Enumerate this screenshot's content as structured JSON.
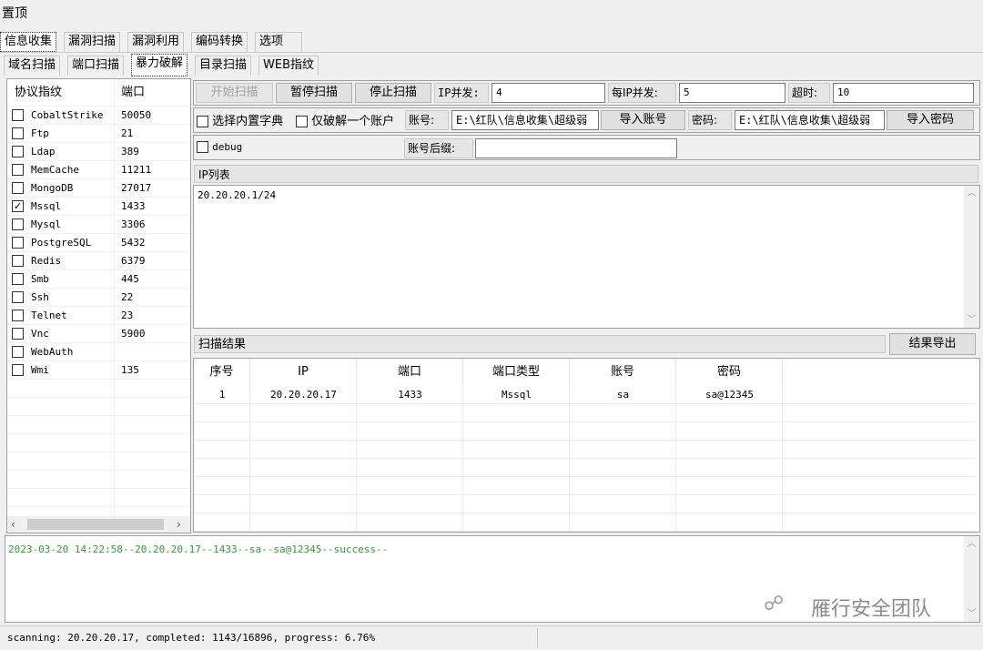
{
  "window": {
    "title": "置顶"
  },
  "top_tabs": [
    "信息收集",
    "漏洞扫描",
    "漏洞利用",
    "编码转换",
    "选项"
  ],
  "sub_tabs": [
    "域名扫描",
    "端口扫描",
    "暴力破解",
    "目录扫描",
    "WEB指纹"
  ],
  "protocols": {
    "header_name": "协议指纹",
    "header_port": "端口",
    "rows": [
      {
        "name": "CobaltStrike",
        "port": "50050",
        "checked": false
      },
      {
        "name": "Ftp",
        "port": "21",
        "checked": false
      },
      {
        "name": "Ldap",
        "port": "389",
        "checked": false
      },
      {
        "name": "MemCache",
        "port": "11211",
        "checked": false
      },
      {
        "name": "MongoDB",
        "port": "27017",
        "checked": false
      },
      {
        "name": "Mssql",
        "port": "1433",
        "checked": true
      },
      {
        "name": "Mysql",
        "port": "3306",
        "checked": false
      },
      {
        "name": "PostgreSQL",
        "port": "5432",
        "checked": false
      },
      {
        "name": "Redis",
        "port": "6379",
        "checked": false
      },
      {
        "name": "Smb",
        "port": "445",
        "checked": false
      },
      {
        "name": "Ssh",
        "port": "22",
        "checked": false
      },
      {
        "name": "Telnet",
        "port": "23",
        "checked": false
      },
      {
        "name": "Vnc",
        "port": "5900",
        "checked": false
      },
      {
        "name": "WebAuth",
        "port": "",
        "checked": false
      },
      {
        "name": "Wmi",
        "port": "135",
        "checked": false
      }
    ]
  },
  "controls": {
    "start_label": "开始扫描",
    "pause_label": "暂停扫描",
    "stop_label": "停止扫描",
    "ip_concurrency_label": "IP并发:",
    "ip_concurrency_value": "4",
    "per_ip_concurrency_label": "每IP并发:",
    "per_ip_concurrency_value": "5",
    "timeout_label": "超时:",
    "timeout_value": "10",
    "builtin_dict_label": "选择内置字典",
    "single_account_label": "仅破解一个账户",
    "account_label": "账号:",
    "account_path": "E:\\红队\\信息收集\\超级弱",
    "import_account_label": "导入账号",
    "password_label": "密码:",
    "password_path": "E:\\红队\\信息收集\\超级弱",
    "import_password_label": "导入密码",
    "debug_label": "debug",
    "suffix_label": "账号后缀:",
    "suffix_value": ""
  },
  "ip_list": {
    "header": "IP列表",
    "content": "20.20.20.1/24"
  },
  "results": {
    "header": "扫描结果",
    "export_label": "结果导出",
    "columns": [
      "序号",
      "IP",
      "端口",
      "端口类型",
      "账号",
      "密码"
    ],
    "rows": [
      [
        "1",
        "20.20.20.17",
        "1433",
        "Mssql",
        "sa",
        "sa@12345"
      ]
    ]
  },
  "log": {
    "line": "2023-03-20 14:22:58--20.20.20.17--1433--sa--sa@12345--success--",
    "color": "#2f9e2f"
  },
  "watermark": "雁行安全团队",
  "status": {
    "text": "scanning: 20.20.20.17, completed: 1143/16896, progress: 6.76%"
  }
}
